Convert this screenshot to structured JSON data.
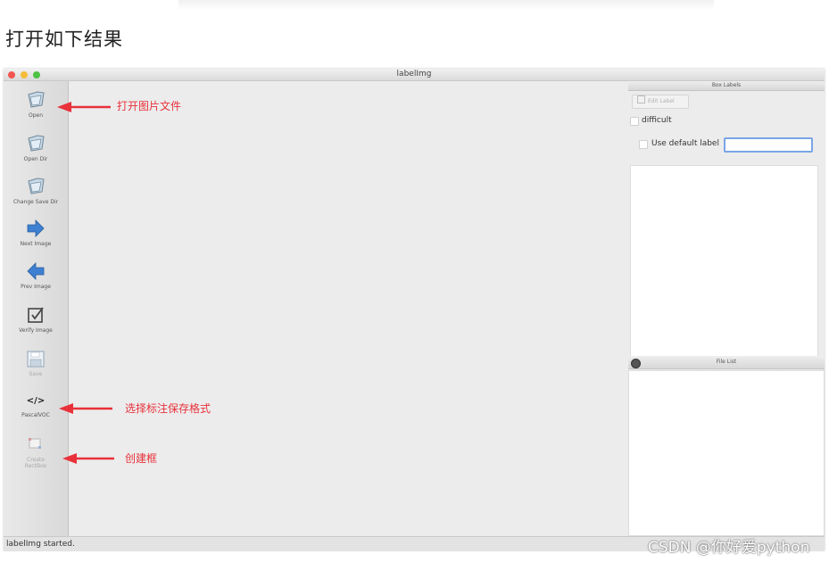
{
  "heading": "打开如下结果",
  "window": {
    "title": "labelImg"
  },
  "toolbar": {
    "items": [
      {
        "label": "Open",
        "icon": "folder-icon",
        "enabled": true
      },
      {
        "label": "Open Dir",
        "icon": "folder-icon",
        "enabled": true
      },
      {
        "label": "Change Save Dir",
        "icon": "folder-icon",
        "enabled": true
      },
      {
        "label": "Next Image",
        "icon": "arrow-right-icon",
        "enabled": true
      },
      {
        "label": "Prev Image",
        "icon": "arrow-left-icon",
        "enabled": true
      },
      {
        "label": "Verify Image",
        "icon": "checkbox-icon",
        "enabled": true
      },
      {
        "label": "Save",
        "icon": "save-icon",
        "enabled": false
      },
      {
        "label": "PascalVOC",
        "icon": "code-icon",
        "enabled": true
      },
      {
        "label": "Create\nRectBox",
        "icon": "rectbox-icon",
        "enabled": false
      }
    ],
    "more_glyph": "»"
  },
  "box_labels": {
    "title": "Box Labels",
    "edit_label": "Edit Label",
    "difficult": "difficult",
    "use_default_label": "Use default label",
    "default_label_value": ""
  },
  "file_list": {
    "title": "File List"
  },
  "status": "labelImg started.",
  "annotations": {
    "open": "打开图片文件",
    "format": "选择标注保存格式",
    "create": "创建框"
  },
  "watermark": "CSDN @你好爱python",
  "colors": {
    "annotation": "#e8313a",
    "accent_input": "#7aa5e6",
    "arrow_blue": "#3d7fd1"
  }
}
